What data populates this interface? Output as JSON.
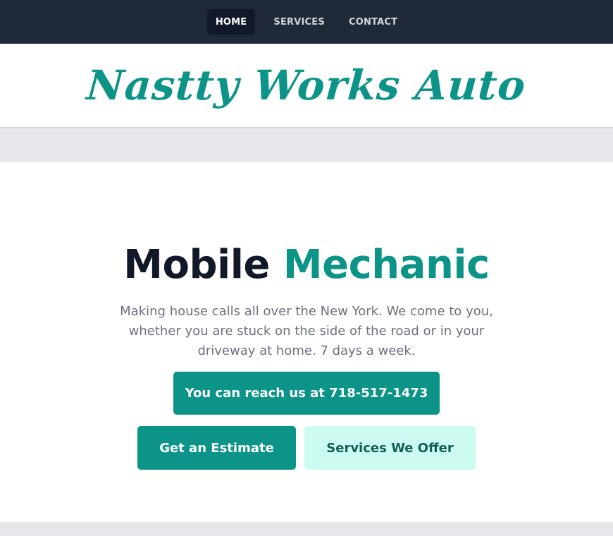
{
  "nav": {
    "items": [
      {
        "label": "HOME",
        "active": true
      },
      {
        "label": "SERVICES",
        "active": false
      },
      {
        "label": "CONTACT",
        "active": false
      }
    ]
  },
  "brand": {
    "name": "Nastty Works Auto",
    "color": "#0d9488"
  },
  "hero": {
    "title_plain": "Mobile",
    "title_accent": "Mechanic",
    "description": "Making house calls all over the New York. We come to you, whether you are stuck on the side of the road or in your driveway at home. 7 days a week.",
    "phone_button": "You can reach us at 718-517-1473",
    "estimate_button": "Get an Estimate",
    "services_button": "Services We Offer"
  },
  "colors": {
    "nav_bg": "#1f2937",
    "accent": "#0d9488",
    "accent_light": "#ccfbf1",
    "text_dark": "#111827",
    "text_muted": "#6b7280"
  }
}
